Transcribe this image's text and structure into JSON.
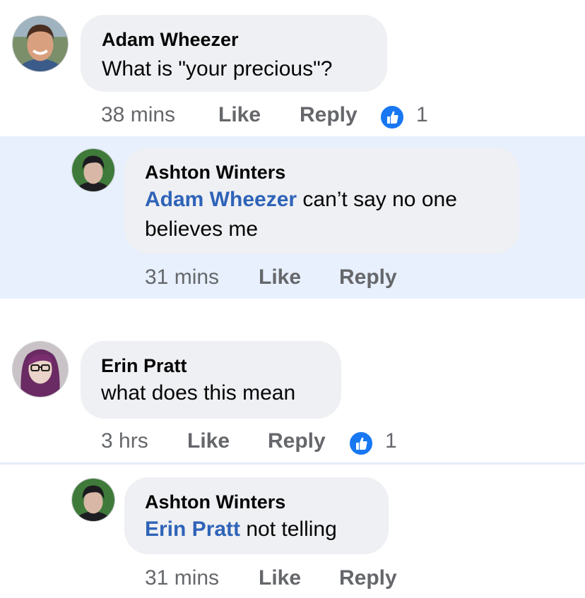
{
  "comments": [
    {
      "author": "Adam Wheezer",
      "text": "What is \"your precious\"?",
      "time": "38 mins",
      "like_label": "Like",
      "reply_label": "Reply",
      "reaction_count": "1"
    },
    {
      "author": "Ashton Winters",
      "mention": "Adam Wheezer",
      "text_line1": " can’t say no one",
      "text_line2": "believes me",
      "time": "31 mins",
      "like_label": "Like",
      "reply_label": "Reply"
    },
    {
      "author": "Erin Pratt",
      "text": "what does this mean",
      "time": "3 hrs",
      "like_label": "Like",
      "reply_label": "Reply",
      "reaction_count": "1"
    },
    {
      "author": "Ashton Winters",
      "mention": "Erin Pratt",
      "text": " not telling",
      "time": "31 mins",
      "like_label": "Like",
      "reply_label": "Reply"
    }
  ],
  "colors": {
    "highlight_band": "#e7f0fc",
    "bubble": "#eff0f3",
    "mention": "#2e63b8",
    "meta_text": "#65676b",
    "like_blue": "#1877f2"
  },
  "icons": {
    "reaction": "thumbs-up-icon"
  }
}
